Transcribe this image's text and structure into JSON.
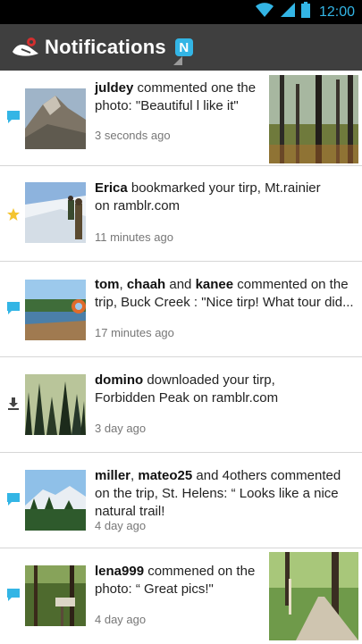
{
  "status_bar": {
    "time": "12:00",
    "icons": [
      "wifi-icon",
      "signal-icon",
      "battery-icon"
    ]
  },
  "action_bar": {
    "title": "Notifications",
    "badge": "N",
    "accent_color": "#33b5e5"
  },
  "notifications": [
    {
      "type": "comment",
      "icon": "comment-icon",
      "thumbnail": "mountain-ridge-photo",
      "actors": [
        {
          "name": "juldey"
        }
      ],
      "text": " commented one the photo: \"Beautiful l like it\"",
      "time": "3 seconds ago",
      "side_photo": "burned-forest-photo"
    },
    {
      "type": "bookmark",
      "icon": "star-icon",
      "thumbnail": "snow-hikers-photo",
      "actors": [
        {
          "name": "Erica"
        }
      ],
      "text": " bookmarked your tirp, Mt.rainier on ramblr.com",
      "time": "11 minutes ago"
    },
    {
      "type": "comment",
      "icon": "comment-icon",
      "thumbnail": "lake-dock-photo",
      "actors": [
        {
          "name": "tom",
          "sep": ", "
        },
        {
          "name": "chaah",
          "sep": " and "
        },
        {
          "name": "kanee"
        }
      ],
      "text": " commented on the trip, Buck Creek : \"Nice tirp! What tour did...",
      "time": "17 minutes ago"
    },
    {
      "type": "download",
      "icon": "download-icon",
      "thumbnail": "forest-peak-photo",
      "actors": [
        {
          "name": "domino"
        }
      ],
      "text": " downloaded your tirp, Forbidden Peak on ramblr.com",
      "time": "3 day ago"
    },
    {
      "type": "comment",
      "icon": "comment-icon",
      "thumbnail": "snow-mountain-photo",
      "actors": [
        {
          "name": "miller",
          "sep": ", "
        },
        {
          "name": "mateo25"
        }
      ],
      "text": " and 4others commented on the trip, St. Helens: “ Looks like a nice natural trail!",
      "time": "4 day ago"
    },
    {
      "type": "comment",
      "icon": "comment-icon",
      "thumbnail": "trail-sign-photo",
      "actors": [
        {
          "name": "lena999"
        }
      ],
      "text": " commened on the photo: “ Great pics!\"",
      "time": "4 day ago",
      "side_photo": "forest-trail-photo"
    }
  ]
}
